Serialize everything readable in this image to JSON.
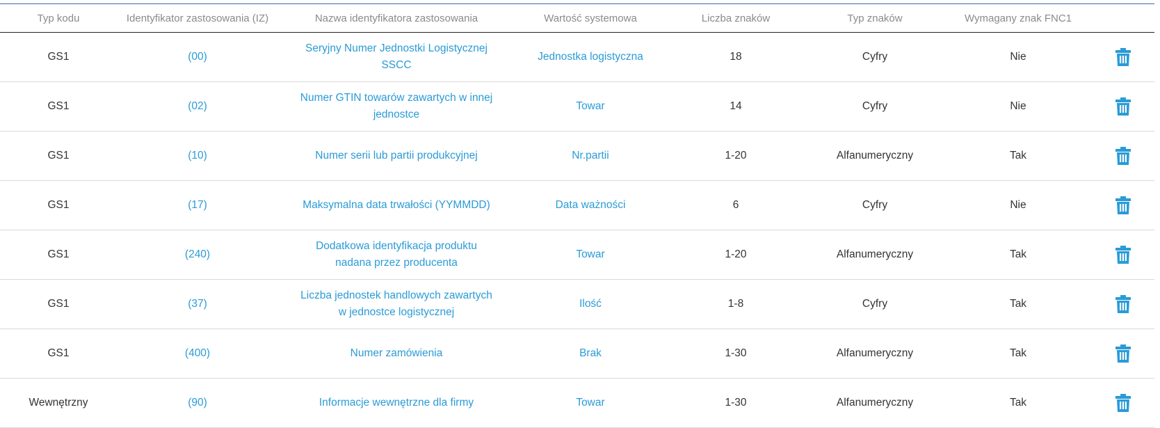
{
  "headers": {
    "code_type": "Typ kodu",
    "ai": "Identyfikator zastosowania (IZ)",
    "ai_name": "Nazwa identyfikatora zastosowania",
    "system_value": "Wartość systemowa",
    "char_count": "Liczba znaków",
    "char_type": "Typ znaków",
    "fnc1": "Wymagany znak FNC1"
  },
  "colors": {
    "link": "#2a9bd6",
    "header_text": "#8a8a8a",
    "top_border": "#2f6fa8",
    "trash_icon": "#2a9bd6"
  },
  "rows": [
    {
      "code_type": "GS1",
      "ai": "(00)",
      "ai_name": "Seryjny Numer Jednostki Logistycznej SSCC",
      "system_value": "Jednostka logistyczna",
      "char_count": "18",
      "char_type": "Cyfry",
      "fnc1": "Nie",
      "delete_icon": "trash-icon"
    },
    {
      "code_type": "GS1",
      "ai": "(02)",
      "ai_name": "Numer GTIN towarów zawartych w innej jednostce",
      "system_value": "Towar",
      "char_count": "14",
      "char_type": "Cyfry",
      "fnc1": "Nie",
      "delete_icon": "trash-icon"
    },
    {
      "code_type": "GS1",
      "ai": "(10)",
      "ai_name": "Numer serii lub partii produkcyjnej",
      "system_value": "Nr.partii",
      "char_count": "1-20",
      "char_type": "Alfanumeryczny",
      "fnc1": "Tak",
      "delete_icon": "trash-icon"
    },
    {
      "code_type": "GS1",
      "ai": "(17)",
      "ai_name": "Maksymalna data trwałości (YYMMDD)",
      "system_value": "Data ważności",
      "char_count": "6",
      "char_type": "Cyfry",
      "fnc1": "Nie",
      "delete_icon": "trash-icon"
    },
    {
      "code_type": "GS1",
      "ai": "(240)",
      "ai_name": "Dodatkowa identyfikacja produktu nadana przez producenta",
      "system_value": "Towar",
      "char_count": "1-20",
      "char_type": "Alfanumeryczny",
      "fnc1": "Tak",
      "delete_icon": "trash-icon"
    },
    {
      "code_type": "GS1",
      "ai": "(37)",
      "ai_name": "Liczba jednostek handlowych zawartych w jednostce logistycznej",
      "system_value": "Ilość",
      "char_count": "1-8",
      "char_type": "Cyfry",
      "fnc1": "Tak",
      "delete_icon": "trash-icon"
    },
    {
      "code_type": "GS1",
      "ai": "(400)",
      "ai_name": "Numer zamówienia",
      "system_value": "Brak",
      "char_count": "1-30",
      "char_type": "Alfanumeryczny",
      "fnc1": "Tak",
      "delete_icon": "trash-icon"
    },
    {
      "code_type": "Wewnętrzny",
      "ai": "(90)",
      "ai_name": "Informacje wewnętrzne dla firmy",
      "system_value": "Towar",
      "char_count": "1-30",
      "char_type": "Alfanumeryczny",
      "fnc1": "Tak",
      "delete_icon": "trash-icon"
    }
  ]
}
